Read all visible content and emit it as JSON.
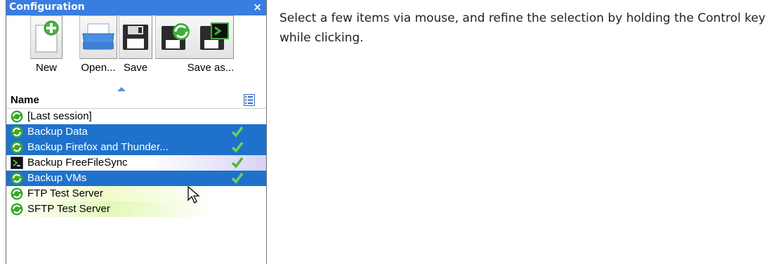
{
  "panel": {
    "title": "Configuration",
    "close_glyph": "×",
    "toolbar": [
      {
        "label": "New",
        "icon": "new-config-icon"
      },
      {
        "label": "Open...",
        "icon": "open-folder-icon"
      },
      {
        "label": "Save",
        "icon": "floppy-save-icon"
      },
      {
        "label": "Save as...",
        "icon": "save-as-batch-icon"
      }
    ],
    "column_header": "Name",
    "items": [
      {
        "label": "[Last session]",
        "icon": "sync-arrows-icon",
        "selected": false,
        "checked": false
      },
      {
        "label": "Backup Data",
        "icon": "sync-arrows-icon",
        "selected": true,
        "checked": true
      },
      {
        "label": "Backup Firefox and Thunder...",
        "icon": "sync-arrows-icon",
        "selected": true,
        "checked": true
      },
      {
        "label": "Backup FreeFileSync",
        "icon": "batch-terminal-icon",
        "selected": false,
        "checked": true
      },
      {
        "label": "Backup VMs",
        "icon": "sync-arrows-icon",
        "selected": true,
        "checked": true
      },
      {
        "label": "FTP Test Server",
        "icon": "sync-arrows-icon",
        "selected": false,
        "checked": false
      },
      {
        "label": "SFTP Test Server",
        "icon": "sync-arrows-icon",
        "selected": false,
        "checked": false
      }
    ]
  },
  "description": "Select a few items via mouse, and refine the selection by holding the Control key while clicking.",
  "colors": {
    "accent": "#3a7de0",
    "selection": "#1e72cc",
    "check": "#4cb83a"
  }
}
